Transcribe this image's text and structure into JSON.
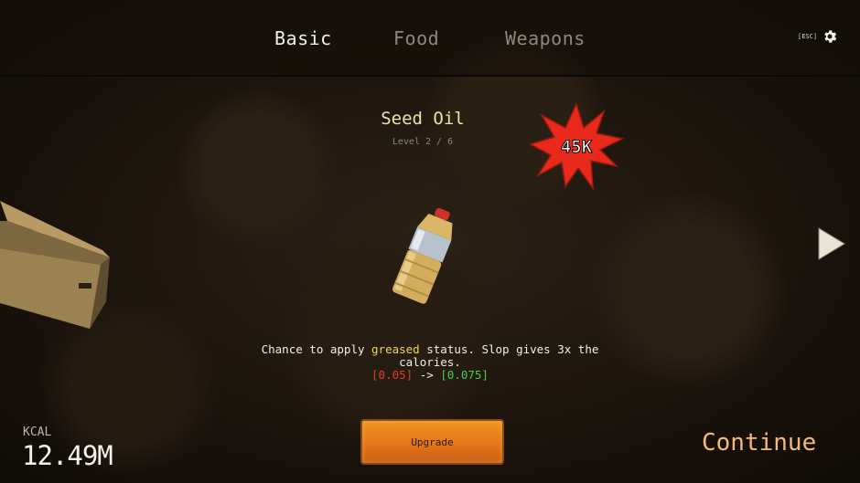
{
  "tabs": [
    {
      "label": "Basic",
      "active": true
    },
    {
      "label": "Food",
      "active": false
    },
    {
      "label": "Weapons",
      "active": false
    }
  ],
  "settings": {
    "esc_label": "[ESC]",
    "icon": "gear-icon"
  },
  "item": {
    "name": "Seed Oil",
    "level": "Level 2 / 6",
    "cost": "45K",
    "description": {
      "part1": "Chance to apply ",
      "highlight": "greased",
      "part2": " status. Slop gives 3x the calories.",
      "old_value": "[0.05]",
      "arrow": " -> ",
      "new_value": "[0.075]"
    }
  },
  "upgrade_label": "Upgrade",
  "kcal": {
    "label": "KCAL",
    "value": "12.49M"
  },
  "continue_label": "Continue",
  "colors": {
    "burst": "#e8291c",
    "upgrade": "#e2731a",
    "continue": "#f4b978",
    "highlight": "#f0d75a",
    "old_value": "#e03a2e",
    "new_value": "#3fd24a"
  }
}
